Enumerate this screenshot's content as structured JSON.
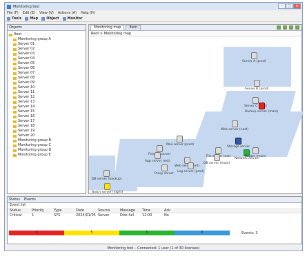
{
  "window": {
    "title": "Monitoring tool",
    "min": "–",
    "max": "□",
    "close": "×"
  },
  "menu": [
    "File (F)",
    "Edit (E)",
    "View (V)",
    "Actions (A)",
    "Help (H)"
  ],
  "toolbar": [
    "Tools",
    "Map",
    "Object",
    "Monitor"
  ],
  "left": {
    "tab": "Objects",
    "root": "Root",
    "items": [
      "Monitoring group A",
      "Server 01",
      "Server 02",
      "Server 03",
      "Server 04",
      "Server 05",
      "Server 06",
      "Server 07",
      "Server 08",
      "Server 09",
      "Server 10",
      "Server 11",
      "Server 12",
      "Server 13",
      "Server 14",
      "Server 15",
      "Server 16",
      "Server 17",
      "Server 18",
      "Server 19",
      "Server 20",
      "Monitoring group B",
      "Monitoring group C",
      "Monitoring group D",
      "Monitoring group E"
    ]
  },
  "right": {
    "tabs": [
      "Monitoring map",
      "Item"
    ],
    "crumb": "Root > Monitoring map"
  },
  "map": {
    "nodes": [
      "Server A (prod)",
      "Server B (prod)",
      "Server C (test)",
      "Backup server (main)",
      "Web server (east)",
      "Storage server",
      "File server (ext)",
      "Mail server (prod)",
      "Firewall server",
      "App server (ext)",
      "Web server (int)",
      "Network device",
      "Router (main)",
      "DB server (main)",
      "Proxy server",
      "Log server (prod)",
      "DB server (backup)",
      "Batch server (night)"
    ]
  },
  "bottom": {
    "tabs": [
      "Status",
      "Events"
    ],
    "sub": "Event list",
    "headers": [
      "Status",
      "Priority",
      "Type",
      "Date",
      "Source",
      "Message",
      "Time",
      "Ack"
    ],
    "row": [
      "Critical",
      "1",
      "SYS",
      "2024/01/05",
      "Server",
      "Disk full",
      "12:00",
      "No"
    ],
    "sev": [
      "0",
      "5",
      "5",
      "8"
    ],
    "count": "Events: 3"
  },
  "status": "Monitoring tool – Connected: 1 user (1 of 30 licenses)",
  "colors": {
    "critical": "#e52323",
    "warning": "#ffe300",
    "normal": "#2ab530",
    "info": "#3a9ad9"
  }
}
